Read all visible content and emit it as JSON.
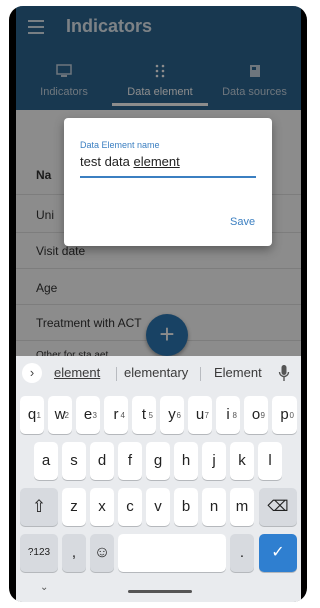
{
  "app": {
    "title": "Indicators"
  },
  "tabs": [
    {
      "label": "Indicators"
    },
    {
      "label": "Data element"
    },
    {
      "label": "Data sources"
    }
  ],
  "list": {
    "header": "Na",
    "items": [
      "Uni",
      "Visit date",
      "Age",
      "Treatment with ACT",
      "Other for sta aet"
    ]
  },
  "fab": {
    "label": "+"
  },
  "dialog": {
    "field_label": "Data Element name",
    "value_prefix": "test data ",
    "value_underlined": "element",
    "save_label": "Save"
  },
  "keyboard": {
    "chevron": "›",
    "suggestions": [
      "element",
      "elementary",
      "Element"
    ],
    "row1": [
      {
        "k": "q",
        "h": "1"
      },
      {
        "k": "w",
        "h": "2"
      },
      {
        "k": "e",
        "h": "3"
      },
      {
        "k": "r",
        "h": "4"
      },
      {
        "k": "t",
        "h": "5"
      },
      {
        "k": "y",
        "h": "6"
      },
      {
        "k": "u",
        "h": "7"
      },
      {
        "k": "i",
        "h": "8"
      },
      {
        "k": "o",
        "h": "9"
      },
      {
        "k": "p",
        "h": "0"
      }
    ],
    "row2": [
      "a",
      "s",
      "d",
      "f",
      "g",
      "h",
      "j",
      "k",
      "l"
    ],
    "row3": [
      "z",
      "x",
      "c",
      "v",
      "b",
      "n",
      "m"
    ],
    "symbols_label": "?123",
    "comma_label": ",",
    "emoji_label": "☺",
    "period_label": ".",
    "enter_label": "✓",
    "shift_label": "⇧",
    "backspace_label": "⌫",
    "nav_chevron": "⌄"
  }
}
